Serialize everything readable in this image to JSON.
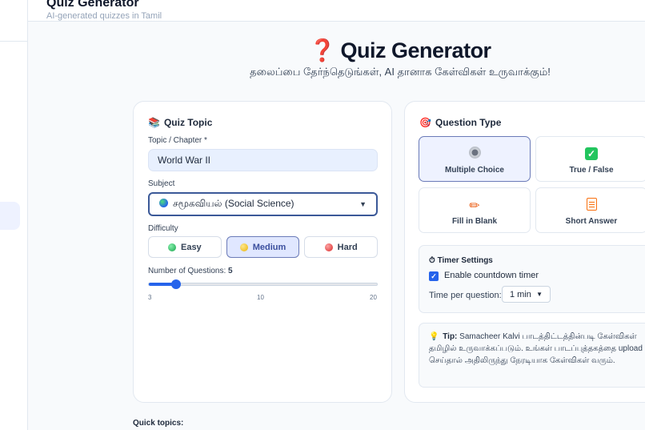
{
  "header": {
    "title": "Quiz Generator",
    "subtitle": "AI-generated quizzes in Tamil"
  },
  "hero": {
    "emoji": "❓",
    "title": "Quiz Generator",
    "subtitle": "தலைப்பை தேர்ந்தெடுங்கள், AI தானாக கேள்விகள் உருவாக்கும்!"
  },
  "quiz_topic": {
    "heading": "Quiz Topic",
    "icon": "📚",
    "topic_label": "Topic / Chapter *",
    "topic_value": "World War II",
    "subject_label": "Subject",
    "subject_value": "சமூகவியல் (Social Science)",
    "difficulty_label": "Difficulty",
    "difficulty_options": [
      "Easy",
      "Medium",
      "Hard"
    ],
    "difficulty_selected": "Medium",
    "num_questions_label": "Number of Questions:",
    "num_questions_value": "5",
    "slider": {
      "min": "3",
      "mid": "10",
      "max": "20",
      "value_fraction": 0.118
    }
  },
  "question_type": {
    "heading": "Question Type",
    "icon": "🎯",
    "options": [
      "Multiple Choice",
      "True / False",
      "Fill in Blank",
      "Short Answer"
    ],
    "selected": "Multiple Choice"
  },
  "timer": {
    "heading": "Timer Settings",
    "icon": "⏱",
    "enable_label": "Enable countdown timer",
    "enabled": true,
    "per_question_label": "Time per question:",
    "per_question_value": "1 min"
  },
  "tip": {
    "prefix": "Tip:",
    "text": "Samacheer Kalvi பாடத்திட்டத்தின்படி கேள்விகள் தமிழில் உருவாக்கப்படும். உங்கள் பாடப்புத்தகத்தை upload செய்தால் அதிலிருந்து நேரடியாக கேள்விகள் வரும்."
  },
  "quick_topics_label": "Quick topics:",
  "colors": {
    "accent": "#2563eb",
    "selected_bg": "#eef2ff",
    "input_bg": "#e8f0fe"
  }
}
